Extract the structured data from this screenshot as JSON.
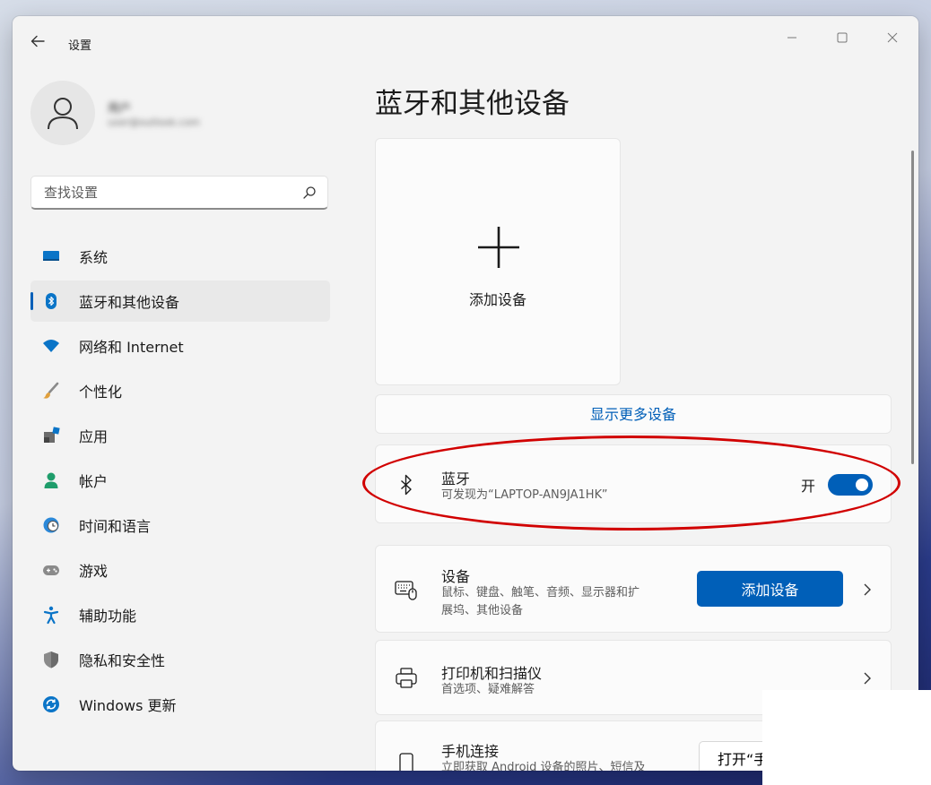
{
  "window": {
    "title": "设置",
    "controls": [
      "minimize",
      "maximize",
      "close"
    ]
  },
  "user": {
    "name": "用户",
    "email": "user@outlook.com"
  },
  "search": {
    "placeholder": "查找设置"
  },
  "sidebar": {
    "items": [
      {
        "label": "系统",
        "icon": "system-icon",
        "active": false
      },
      {
        "label": "蓝牙和其他设备",
        "icon": "bluetooth-icon",
        "active": true
      },
      {
        "label": "网络和 Internet",
        "icon": "wifi-icon",
        "active": false
      },
      {
        "label": "个性化",
        "icon": "brush-icon",
        "active": false
      },
      {
        "label": "应用",
        "icon": "apps-icon",
        "active": false
      },
      {
        "label": "帐户",
        "icon": "account-icon",
        "active": false
      },
      {
        "label": "时间和语言",
        "icon": "clock-globe-icon",
        "active": false
      },
      {
        "label": "游戏",
        "icon": "gamepad-icon",
        "active": false
      },
      {
        "label": "辅助功能",
        "icon": "accessibility-icon",
        "active": false
      },
      {
        "label": "隐私和安全性",
        "icon": "shield-icon",
        "active": false
      },
      {
        "label": "Windows 更新",
        "icon": "update-icon",
        "active": false
      }
    ]
  },
  "main": {
    "title": "蓝牙和其他设备",
    "add_tile_label": "添加设备",
    "show_more": "显示更多设备",
    "bluetooth": {
      "title": "蓝牙",
      "subtitle": "可发现为“LAPTOP-AN9JA1HK”",
      "toggle_label": "开",
      "enabled": true
    },
    "devices": {
      "title": "设备",
      "subtitle_line1": "鼠标、键盘、触笔、音频、显示器和扩",
      "subtitle_line2": "展坞、其他设备",
      "button": "添加设备"
    },
    "printers": {
      "title": "打印机和扫描仪",
      "subtitle": "首选项、疑难解答"
    },
    "phone": {
      "title": "手机连接",
      "subtitle": "立即获取 Android 设备的照片、短信及",
      "button": "打开“手"
    }
  },
  "colors": {
    "accent": "#005fb8",
    "annotation": "#d10000"
  }
}
